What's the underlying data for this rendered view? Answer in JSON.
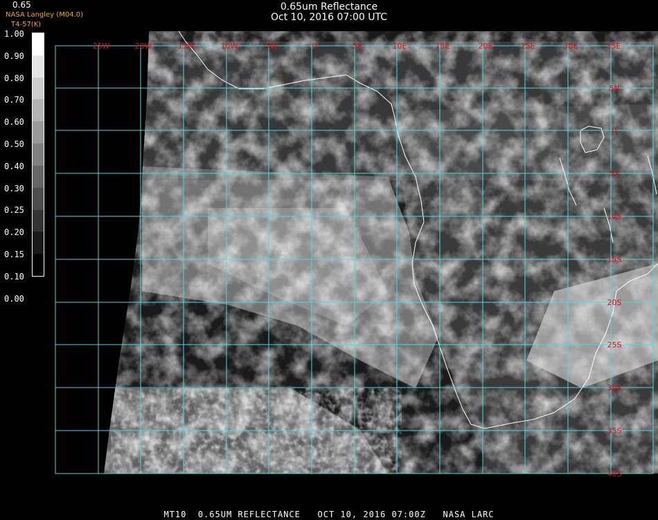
{
  "header": {
    "title": "0.65um Reflectance",
    "subtitle": "Oct 10, 2016 07:00 UTC",
    "credit": "NASA Langley (M04.0)",
    "credit_sub": "T4-57(K)",
    "scale_top": "0.65"
  },
  "colorbar": {
    "labels": [
      "1.00",
      "0.90",
      "0.80",
      "0.70",
      "0.60",
      "0.50",
      "0.40",
      "0.30",
      "0.25",
      "0.20",
      "0.15",
      "0.10",
      "0.00"
    ]
  },
  "grid": {
    "lon_labels": [
      "25W",
      "20W",
      "15W",
      "10W",
      "5W",
      "0",
      "5E",
      "10E",
      "15E",
      "20E",
      "25E",
      "30E",
      "35E"
    ],
    "lat_labels": [
      "5N",
      "0",
      "5S",
      "10S",
      "15S",
      "20S",
      "25S",
      "30S",
      "35S",
      "40S"
    ],
    "color": "#4fd8e0",
    "label_color": "#e01010"
  },
  "footer": {
    "text": "MT10  0.65UM REFLECTANCE   OCT 10, 2016 07:00Z   NASA LARC"
  }
}
